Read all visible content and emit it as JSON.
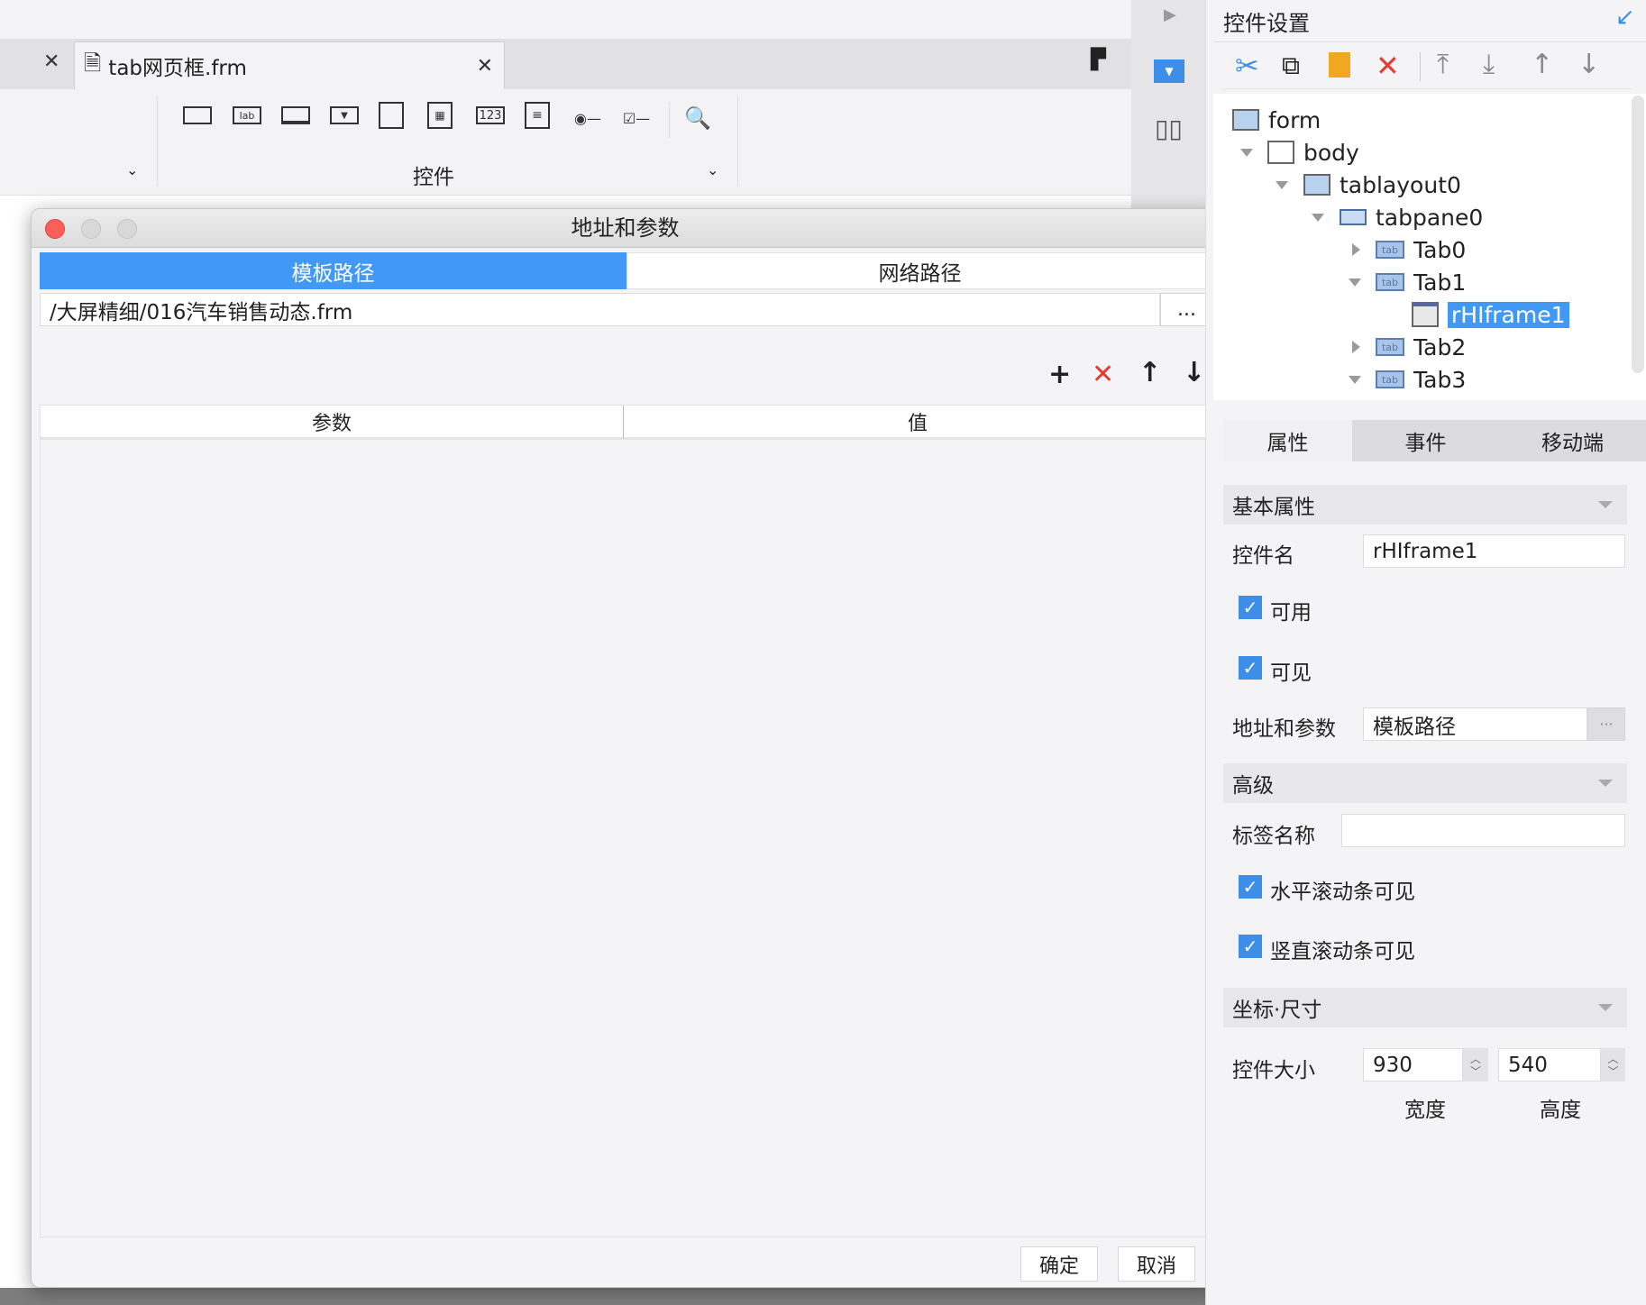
{
  "editor": {
    "doc_tab": "tab网页框.frm",
    "ribbon_group": "控件"
  },
  "dialog": {
    "title": "地址和参数",
    "tabs": [
      "模板路径",
      "网络路径"
    ],
    "path_value": "/大屏精细/016汽车销售动态.frm",
    "browse_label": "...",
    "table_headers": [
      "参数",
      "值"
    ],
    "ok": "确定",
    "cancel": "取消"
  },
  "panel": {
    "title": "控件设置",
    "tree": [
      {
        "label": "form"
      },
      {
        "label": "body"
      },
      {
        "label": "tablayout0"
      },
      {
        "label": "tabpane0"
      },
      {
        "label": "Tab0"
      },
      {
        "label": "Tab1"
      },
      {
        "label": "rHIframe1",
        "selected": true
      },
      {
        "label": "Tab2"
      },
      {
        "label": "Tab3"
      }
    ],
    "tabs": [
      "属性",
      "事件",
      "移动端"
    ],
    "sections": {
      "basic": "基本属性",
      "advanced": "高级",
      "geometry": "坐标·尺寸"
    },
    "name_label": "控件名",
    "name_value": "rHIframe1",
    "enabled_label": "可用",
    "enabled": true,
    "visible_label": "可见",
    "visible": true,
    "url_label": "地址和参数",
    "url_value": "模板路径",
    "url_btn": "···",
    "tab_name_label": "标签名称",
    "tab_name_value": "",
    "hscroll_label": "水平滚动条可见",
    "hscroll": true,
    "vscroll_label": "竖直滚动条可见",
    "vscroll": true,
    "size_label": "控件大小",
    "width": "930",
    "height": "540",
    "width_label": "宽度",
    "height_label": "高度"
  },
  "colors": {
    "accent": "#4299f5",
    "delete": "#e83a30"
  }
}
